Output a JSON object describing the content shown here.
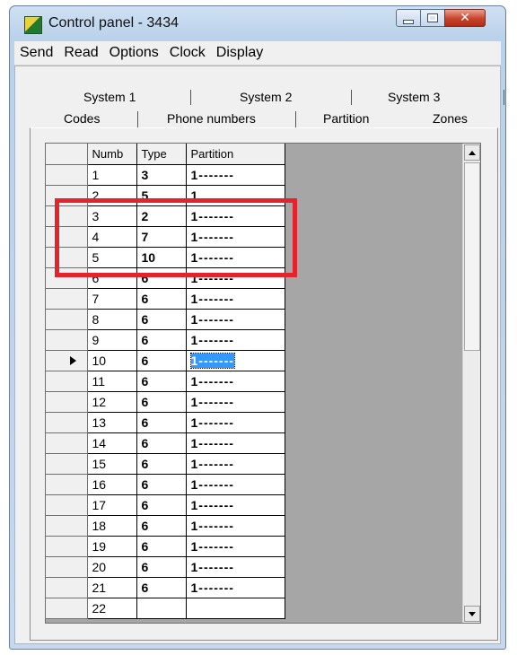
{
  "window": {
    "title": "Control panel - 3434",
    "minimize_icon": "minimize-icon",
    "maximize_icon": "maximize-icon",
    "close_icon": "close-icon",
    "close_glyph": "✕"
  },
  "menu": [
    "Send",
    "Read",
    "Options",
    "Clock",
    "Display"
  ],
  "tabs": {
    "row1": [
      "System 1",
      "System 2",
      "System 3"
    ],
    "row2": [
      "Codes",
      "Phone numbers",
      "Partition",
      "Zones"
    ],
    "active": "Zones"
  },
  "grid": {
    "headers": [
      "Numb",
      "Type",
      "Partition"
    ],
    "rows": [
      {
        "numb": "1",
        "type": "3",
        "partition": "1-------"
      },
      {
        "numb": "2",
        "type": "5",
        "partition": "1"
      },
      {
        "numb": "3",
        "type": "2",
        "partition": "1-------"
      },
      {
        "numb": "4",
        "type": "7",
        "partition": "1-------"
      },
      {
        "numb": "5",
        "type": "10",
        "partition": "1-------"
      },
      {
        "numb": "6",
        "type": "6",
        "partition": "1-------"
      },
      {
        "numb": "7",
        "type": "6",
        "partition": "1-------"
      },
      {
        "numb": "8",
        "type": "6",
        "partition": "1-------"
      },
      {
        "numb": "9",
        "type": "6",
        "partition": "1-------"
      },
      {
        "numb": "10",
        "type": "6",
        "partition": "1-------",
        "current": true,
        "selected_cell": "partition"
      },
      {
        "numb": "11",
        "type": "6",
        "partition": "1-------"
      },
      {
        "numb": "12",
        "type": "6",
        "partition": "1-------"
      },
      {
        "numb": "13",
        "type": "6",
        "partition": "1-------"
      },
      {
        "numb": "14",
        "type": "6",
        "partition": "1-------"
      },
      {
        "numb": "15",
        "type": "6",
        "partition": "1-------"
      },
      {
        "numb": "16",
        "type": "6",
        "partition": "1-------"
      },
      {
        "numb": "17",
        "type": "6",
        "partition": "1-------"
      },
      {
        "numb": "18",
        "type": "6",
        "partition": "1-------"
      },
      {
        "numb": "19",
        "type": "6",
        "partition": "1-------"
      },
      {
        "numb": "20",
        "type": "6",
        "partition": "1-------"
      },
      {
        "numb": "21",
        "type": "6",
        "partition": "1-------"
      },
      {
        "numb": "22",
        "type": "",
        "partition": ""
      }
    ]
  },
  "colors": {
    "annotation_box": "#e5232c",
    "selection": "#3399ff",
    "grid_background": "#a6a6a6"
  }
}
